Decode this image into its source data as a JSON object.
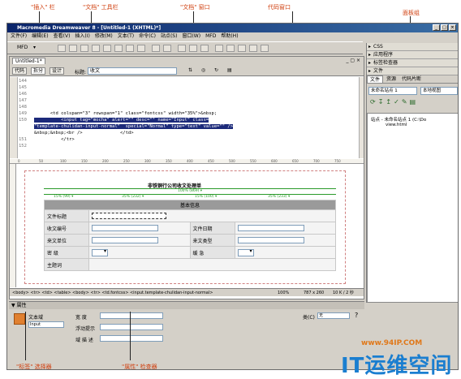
{
  "callouts": {
    "insert_bar": "\"插入\" 栏",
    "doc_toolbar": "\"文档\" 工具栏",
    "doc_window": "\"文档\" 窗口",
    "code_window": "代码窗口",
    "panel_groups": "面板组",
    "tag_selector": "\"标签\" 选择器",
    "property_inspector": "\"属性\" 检查器"
  },
  "window": {
    "title": "Macromedia Dreamweaver 8 - [Untitled-1 (XHTML)*]",
    "controls": [
      "_",
      "□",
      "×"
    ]
  },
  "menu": [
    "文件(F)",
    "编辑(E)",
    "查看(V)",
    "插入(I)",
    "修改(M)",
    "文本(T)",
    "命令(C)",
    "站点(S)",
    "窗口(W)",
    "MFD",
    "帮助(H)"
  ],
  "toolbar": {
    "insert_dropdown": "MFD"
  },
  "document": {
    "tab_name": "Untitled-1*",
    "view_code": "代码",
    "view_split": "拆分",
    "view_design": "设计",
    "title_label": "标题:",
    "title_value": "收文"
  },
  "code_lines": [
    {
      "num": "144",
      "text": ""
    },
    {
      "num": "145",
      "text": ""
    },
    {
      "num": "146",
      "text": ""
    },
    {
      "num": "147",
      "text": ""
    },
    {
      "num": "148",
      "text": ""
    },
    {
      "num": "149",
      "text": "      <td colspan=\"3\" rowspan=\"1\" class=\"fontcss\" width=\"35%\">&nbsp;"
    },
    {
      "num": "150",
      "text": "          <input tag=\"mocha\" alert=\"\" desc=\"\" name=\"Input\" class="
    },
    {
      "num": "",
      "text": "\"template-chulidan-input-normal\"  special=\"Normal\" type=\"text\" value=\"\" />"
    },
    {
      "num": "",
      "text": "&nbsp;&nbsp;<br />              </td>"
    },
    {
      "num": "151",
      "text": "          </tr>"
    },
    {
      "num": "152",
      "text": ""
    }
  ],
  "ruler": [
    "0",
    "50",
    "100",
    "150",
    "200",
    "250",
    "300",
    "350",
    "400",
    "450",
    "500",
    "550",
    "600",
    "650",
    "700",
    "750"
  ],
  "form": {
    "heading": "非铁铜行公司收文处理单",
    "width_total": "100% (869) ▾",
    "col_widths": [
      "15% (99) ▾",
      "35% (232) ▾",
      "15% (100) ▾",
      "35% (233) ▾"
    ],
    "section": "基本信息",
    "rows": [
      {
        "l1": "文件标题",
        "l2": "",
        "l3": ""
      },
      {
        "l1": "收文编号",
        "l2": "文件日期",
        "l3": ""
      },
      {
        "l1": "来文单位",
        "l2": "来文类型",
        "l3": ""
      },
      {
        "l1": "密 级",
        "l2": "缓 急",
        "l3": ""
      },
      {
        "l1": "主题词",
        "l2": "",
        "l3": ""
      }
    ]
  },
  "statusbar": {
    "tags": "<body> <tr> <td> <table> <body> <tr> <td.fontcss> <input.template-chulidan-input-normal>",
    "zoom": "100%",
    "size": "787 x 260",
    "weight": "10 K / 2 秒"
  },
  "panels": {
    "groups": [
      "CSS",
      "应用程序",
      "标签检查器",
      "文件"
    ],
    "file_tabs": [
      "文件",
      "资源",
      "代码片断"
    ],
    "site_dropdown": "未命名站点 1",
    "view_dropdown": "本地视图",
    "tree": [
      "站点 - 未命名站点 1 (C:\\Do",
      "view.html"
    ]
  },
  "properties": {
    "header": "▼ 属性",
    "element_name": "文本域",
    "element_id": "Input",
    "width_label": "宽 度",
    "hint_label": "浮动提示",
    "desc_label": "域 描 述",
    "class_label": "类(C)",
    "class_value": "无"
  },
  "watermark": {
    "url": "www.94IP.COM",
    "brand": "IT运维空间"
  },
  "colors": {
    "callout": "#d04010",
    "selection": "#1c2a7a",
    "watermark_url": "#e0781a",
    "watermark_brand": "#1a7ed0"
  }
}
